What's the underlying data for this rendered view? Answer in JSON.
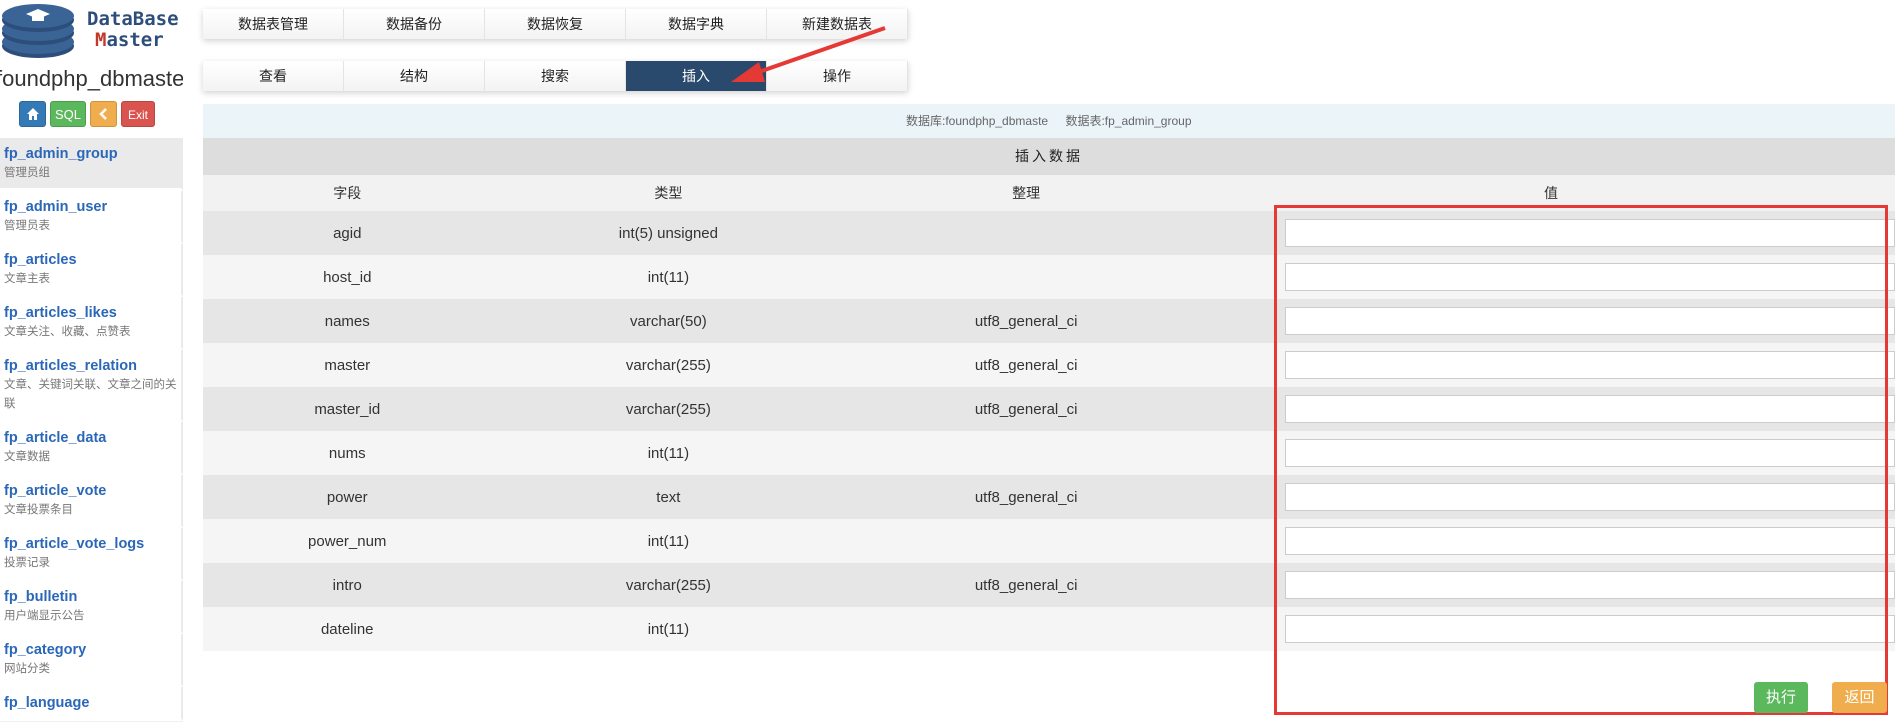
{
  "logo": {
    "line1": "DataBase",
    "line2_prefix": "",
    "line2_accent": "M",
    "line2_rest": "aster"
  },
  "sidebar": {
    "db_name": "foundphp_dbmaster",
    "buttons": {
      "sql": "SQL",
      "exit": "Exit"
    },
    "tables": [
      {
        "name": "fp_admin_group",
        "desc": "管理员组"
      },
      {
        "name": "fp_admin_user",
        "desc": "管理员表"
      },
      {
        "name": "fp_articles",
        "desc": "文章主表"
      },
      {
        "name": "fp_articles_likes",
        "desc": "文章关注、收藏、点赞表"
      },
      {
        "name": "fp_articles_relation",
        "desc": "文章、关键词关联、文章之间的关联"
      },
      {
        "name": "fp_article_data",
        "desc": "文章数据"
      },
      {
        "name": "fp_article_vote",
        "desc": "文章投票条目"
      },
      {
        "name": "fp_article_vote_logs",
        "desc": "投票记录"
      },
      {
        "name": "fp_bulletin",
        "desc": "用户端显示公告"
      },
      {
        "name": "fp_category",
        "desc": "网站分类"
      },
      {
        "name": "fp_language",
        "desc": ""
      }
    ]
  },
  "top_tabs": [
    "数据表管理",
    "数据备份",
    "数据恢复",
    "数据字典",
    "新建数据表"
  ],
  "sub_tabs": [
    "查看",
    "结构",
    "搜索",
    "插入",
    "操作"
  ],
  "active_sub_tab": "插入",
  "info": {
    "database": "数据库:foundphp_dbmaste",
    "table": "数据表:fp_admin_group"
  },
  "panel_title": "插入数据",
  "columns": [
    "字段",
    "类型",
    "整理",
    "值"
  ],
  "rows": [
    {
      "field": "agid",
      "type": "int(5) unsigned",
      "collation": "",
      "value": ""
    },
    {
      "field": "host_id",
      "type": "int(11)",
      "collation": "",
      "value": ""
    },
    {
      "field": "names",
      "type": "varchar(50)",
      "collation": "utf8_general_ci",
      "value": ""
    },
    {
      "field": "master",
      "type": "varchar(255)",
      "collation": "utf8_general_ci",
      "value": ""
    },
    {
      "field": "master_id",
      "type": "varchar(255)",
      "collation": "utf8_general_ci",
      "value": ""
    },
    {
      "field": "nums",
      "type": "int(11)",
      "collation": "",
      "value": ""
    },
    {
      "field": "power",
      "type": "text",
      "collation": "utf8_general_ci",
      "value": ""
    },
    {
      "field": "power_num",
      "type": "int(11)",
      "collation": "",
      "value": ""
    },
    {
      "field": "intro",
      "type": "varchar(255)",
      "collation": "utf8_general_ci",
      "value": ""
    },
    {
      "field": "dateline",
      "type": "int(11)",
      "collation": "",
      "value": ""
    }
  ],
  "actions": {
    "execute": "执行",
    "back": "返回"
  },
  "colors": {
    "accent_tab": "#2a4a6d",
    "link": "#2a67b8",
    "highlight_box": "#e53935",
    "green": "#5cb85c",
    "orange": "#f0ad4e",
    "red": "#d9534f",
    "blue": "#337ab7"
  },
  "icons": {
    "home": "home-icon",
    "back": "chevron-left-icon",
    "logo": "database-stack-icon"
  }
}
